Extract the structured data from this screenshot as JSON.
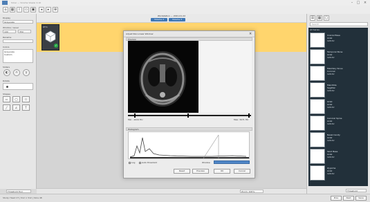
{
  "app": {
    "title": "Slicer — Volume Viewer 4.10",
    "window_controls": {
      "minimize": "–",
      "maximize": "□",
      "close": "×"
    }
  },
  "toolbar": {
    "buttons": [
      {
        "icon": "home-icon",
        "glyph": "⌂"
      },
      {
        "icon": "grid-icon",
        "glyph": "▦"
      },
      {
        "icon": "info-icon",
        "glyph": "i"
      },
      {
        "icon": "folder-icon",
        "glyph": "▭"
      },
      {
        "icon": "image-icon",
        "glyph": "▣"
      },
      {
        "icon": "arrow-left-icon",
        "glyph": "◂"
      },
      {
        "icon": "arrow-right-icon",
        "glyph": "▸"
      },
      {
        "icon": "zoom-icon",
        "glyph": "⊕"
      }
    ]
  },
  "left_panel": {
    "section_labels": {
      "display": "Display",
      "rename": "Rename",
      "colors": "Colors"
    },
    "display": {
      "value": "Grayscale"
    },
    "window_level": {
      "label": "Window / Level",
      "left": "100",
      "right": "350"
    },
    "rename": {
      "value": ""
    },
    "colors": {
      "items": [
        "Grayscale",
        "Custom"
      ]
    },
    "sliders_label": "Sliders",
    "rotate_label": "Rotate",
    "shapes_label": "Shapes"
  },
  "center": {
    "header_title": "Workstation — 2021-01-22",
    "header_tabs": [
      "Volume 2",
      "Volume 3"
    ],
    "thumbnail": {
      "label": "CT 1",
      "badge": "✓"
    },
    "status_left": "Threshold Tool",
    "status_right_left": "Zoom: 100%",
    "status_right": "Threshold"
  },
  "dialog": {
    "title": "Adjust Non-Linear Window",
    "preview_label": "Preview",
    "slider": {
      "min_label": "Min: -1024 HU",
      "max_label": "Max: 3071 HU",
      "position": 0.05
    },
    "histogram_label": "Histogram",
    "checkboxes": [
      {
        "label": "Log",
        "checked": false
      },
      {
        "label": "Auto threshold",
        "checked": false
      }
    ],
    "window_label": "Window",
    "buttons": [
      "Reset",
      "Preview",
      "OK",
      "Cancel"
    ]
  },
  "right_panel": {
    "search_placeholder": "Search",
    "list_title": "All Series",
    "items": [
      {
        "name": "Cranial Base",
        "sub1": "Axial",
        "sub2": "120 kV"
      },
      {
        "name": "Temporal Bone",
        "sub1": "Axial",
        "sub2": "120 kV"
      },
      {
        "name": "Maxillary Sinus",
        "sub1": "Coronal",
        "sub2": "120 kV"
      },
      {
        "name": "Mandible",
        "sub1": "Sagittal",
        "sub2": "120 kV"
      },
      {
        "name": "Orbit",
        "sub1": "Axial",
        "sub2": "120 kV"
      },
      {
        "name": "Cervical Spine",
        "sub1": "Axial",
        "sub2": "120 kV"
      },
      {
        "name": "Nasal Cavity",
        "sub1": "Axial",
        "sub2": "120 kV"
      },
      {
        "name": "Skull Base",
        "sub1": "Axial",
        "sub2": "120 kV"
      },
      {
        "name": "Zygoma",
        "sub1": "Axial",
        "sub2": "120 kV"
      }
    ]
  },
  "bottom": {
    "left_text": "Study: Head CT | 512 × 512 | Slice 48",
    "right_buttons": [
      "Prev",
      "Next",
      "Save"
    ]
  }
}
